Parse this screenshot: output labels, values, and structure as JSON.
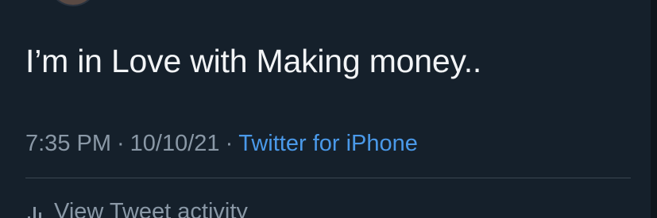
{
  "tweet": {
    "text": "I’m in Love with Making money.."
  },
  "meta": {
    "time": "7:35 PM",
    "separator": "·",
    "date": "10/10/21",
    "source": "Twitter for iPhone"
  },
  "activity": {
    "label": "View Tweet activity",
    "icon": "bar-chart-icon"
  },
  "colors": {
    "background": "#15202b",
    "text_primary": "#f2f4f6",
    "text_secondary": "#8a98a6",
    "link": "#4a99e9",
    "divider": "#3a4651"
  }
}
